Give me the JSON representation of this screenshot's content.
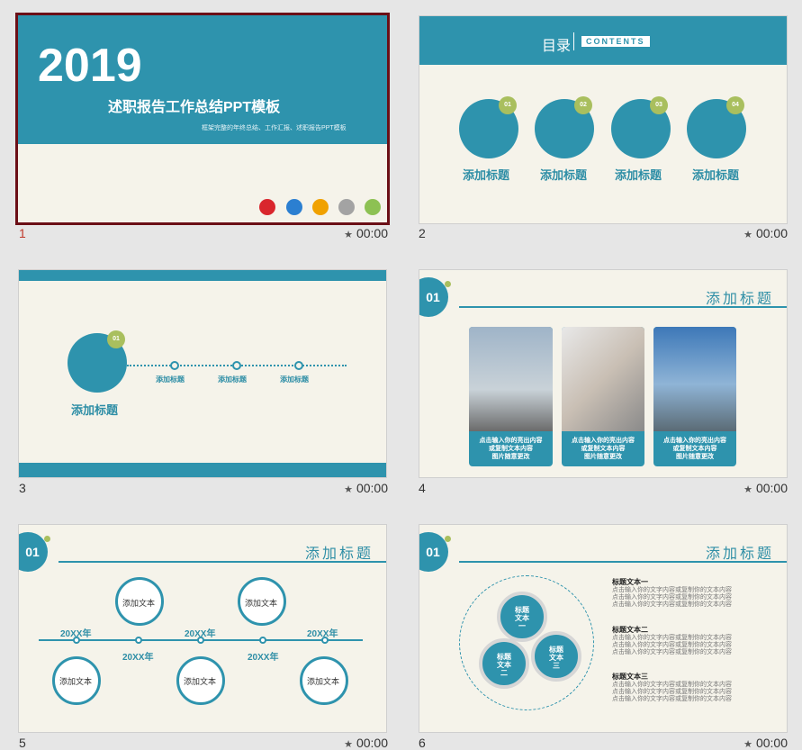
{
  "slides": [
    {
      "num": "1",
      "time": "00:00",
      "year": "2019",
      "title": "述职报告工作总结PPT模板",
      "subtitle": "框架完整的年终总结、工作汇报、述职报告PPT模板"
    },
    {
      "num": "2",
      "time": "00:00",
      "toc": "目录",
      "contents": "CONTENTS",
      "items": [
        {
          "badge": "01",
          "label": "添加标题"
        },
        {
          "badge": "02",
          "label": "添加标题"
        },
        {
          "badge": "03",
          "label": "添加标题"
        },
        {
          "badge": "04",
          "label": "添加标题"
        }
      ]
    },
    {
      "num": "3",
      "time": "00:00",
      "badge": "01",
      "label": "添加标题",
      "dots": [
        "添加标题",
        "添加标题",
        "添加标题"
      ]
    },
    {
      "num": "4",
      "time": "00:00",
      "section": "01",
      "title": "添加标题",
      "cards": [
        {
          "l1": "点击输入你的亮出内容",
          "l2": "或复制文本内容",
          "l3": "图片随意更改"
        },
        {
          "l1": "点击输入你的亮出内容",
          "l2": "或复制文本内容",
          "l3": "图片随意更改"
        },
        {
          "l1": "点击输入你的亮出内容",
          "l2": "或复制文本内容",
          "l3": "图片随意更改"
        }
      ]
    },
    {
      "num": "5",
      "time": "00:00",
      "section": "01",
      "title": "添加标题",
      "years_top": [
        "20XX年",
        "20XX年",
        "20XX年"
      ],
      "years_bottom": [
        "20XX年",
        "20XX年"
      ],
      "bubbles_top": [
        "添加文本",
        "添加文本"
      ],
      "bubbles_bottom": [
        "添加文本",
        "添加文本",
        "添加文本"
      ]
    },
    {
      "num": "6",
      "time": "00:00",
      "section": "01",
      "title": "添加标题",
      "circles": [
        {
          "l1": "标题",
          "l2": "文本",
          "l3": "一"
        },
        {
          "l1": "标题",
          "l2": "文本",
          "l3": "二"
        },
        {
          "l1": "标题",
          "l2": "文本",
          "l3": "三"
        }
      ],
      "texts": [
        {
          "head": "标题文本一",
          "lines": [
            "点击输入你的文字内容或复制你的文本内容",
            "点击输入你的文字内容或复制你的文本内容",
            "点击输入你的文字内容或复制你的文本内容"
          ]
        },
        {
          "head": "标题文本二",
          "lines": [
            "点击输入你的文字内容或复制你的文本内容",
            "点击输入你的文字内容或复制你的文本内容",
            "点击输入你的文字内容或复制你的文本内容"
          ]
        },
        {
          "head": "标题文本三",
          "lines": [
            "点击输入你的文字内容或复制你的文本内容",
            "点击输入你的文字内容或复制你的文本内容",
            "点击输入你的文字内容或复制你的文本内容"
          ]
        }
      ]
    }
  ],
  "icons": {
    "star": "star-icon"
  },
  "colors": {
    "accent": "#2e93ad",
    "green": "#a9bf5e",
    "selected": "#6b0f16"
  }
}
